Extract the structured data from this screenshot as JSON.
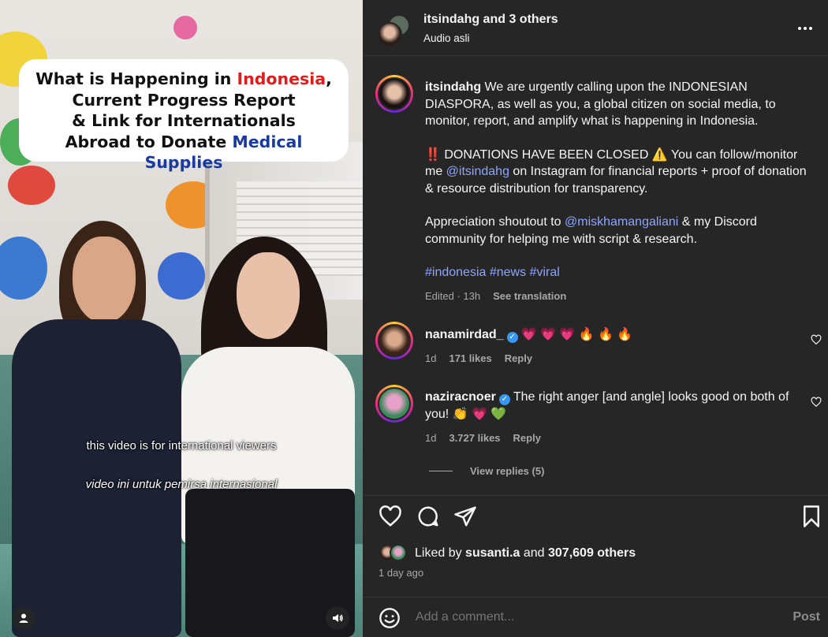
{
  "media": {
    "title_line1_pre": "What is Happening in ",
    "title_line1_red": "Indonesia",
    "title_line1_post": ",",
    "title_line2": "Current Progress Report",
    "title_line3": "& Link for Internationals",
    "title_line4_pre": "Abroad to Donate ",
    "title_line4_blue": "Medical Supplies",
    "caption_en": "this video is for international viewers",
    "caption_id": "video ini untuk pemirsa internasional",
    "colors": {
      "red": "#e21b1b",
      "blue": "#1a3aa0"
    }
  },
  "header": {
    "username": "itsindahg",
    "others": " and 3 others",
    "audio": "Audio asli"
  },
  "post": {
    "username": "itsindahg",
    "text1": " We are urgently calling upon the INDONESIAN DIASPORA, as well as you, a global citizen on social media, to monitor, report, and amplify what is happening in Indonesia.",
    "p2_pre": "‼️ DONATIONS HAVE BEEN CLOSED ⚠️ You can follow/monitor me ",
    "p2_mention": "@itsindahg",
    "p2_post": " on Instagram for financial reports + proof of donation & resource distribution for transparency.",
    "p3_pre": "Appreciation shoutout to ",
    "p3_mention": "@miskhamangaliani",
    "p3_post": " & my Discord community for helping me with script & research.",
    "hashtags": "#indonesia #news #viral",
    "edited": "Edited · 13h",
    "see_translation": "See translation"
  },
  "comments": [
    {
      "username": "nanamirdad_",
      "text": "💗 💗 💗 🔥 🔥 🔥",
      "time": "1d",
      "likes": "171 likes",
      "reply": "Reply"
    },
    {
      "username": "naziracnoer",
      "text": "The right anger [and angle] looks good on both of you! 👏 💗 💚",
      "time": "1d",
      "likes": "3.727 likes",
      "reply": "Reply"
    }
  ],
  "view_replies": "View replies (5)",
  "likes": {
    "prefix": "Liked by ",
    "user": "susanti.a",
    "mid": " and ",
    "count": "307,609 others"
  },
  "time_ago": "1 day ago",
  "comment_box": {
    "placeholder": "Add a comment...",
    "post_label": "Post"
  },
  "icons": {
    "more": "more-icon",
    "heart": "heart-icon",
    "comment": "comment-icon",
    "share": "share-icon",
    "save": "bookmark-icon",
    "emoji": "emoji-icon",
    "user": "user-icon",
    "volume": "volume-icon"
  }
}
